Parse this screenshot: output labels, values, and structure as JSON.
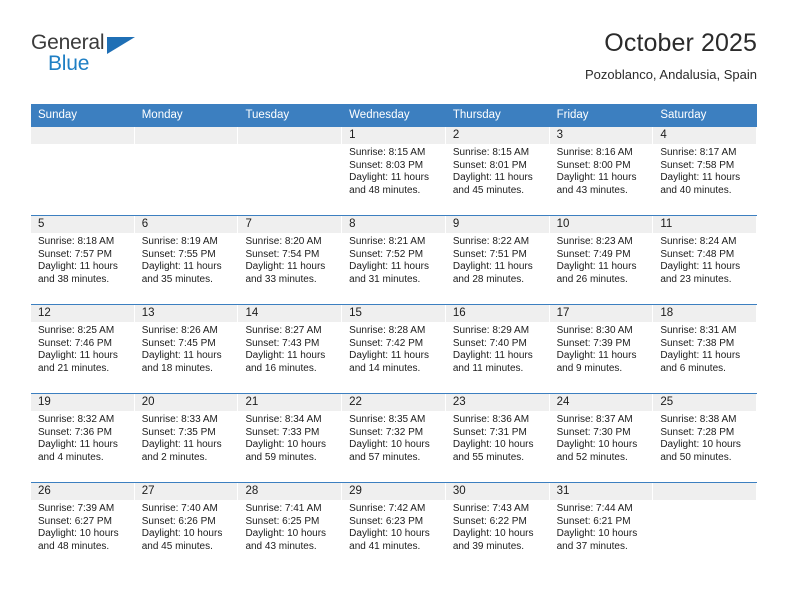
{
  "brand": {
    "name_top": "General",
    "name_bottom": "Blue",
    "accent_color": "#1f7fc4",
    "triangle_color": "#1f6fb5"
  },
  "header": {
    "title": "October 2025",
    "subtitle": "Pozoblanco, Andalusia, Spain"
  },
  "calendar": {
    "header_bg": "#3c7fc0",
    "date_band_bg": "#efefef",
    "weekdays": [
      "Sunday",
      "Monday",
      "Tuesday",
      "Wednesday",
      "Thursday",
      "Friday",
      "Saturday"
    ],
    "labels": {
      "sunrise": "Sunrise:",
      "sunset": "Sunset:",
      "daylight": "Daylight:"
    },
    "weeks": [
      [
        {
          "day": "",
          "empty": true
        },
        {
          "day": "",
          "empty": true
        },
        {
          "day": "",
          "empty": true
        },
        {
          "day": "1",
          "sunrise": "Sunrise: 8:15 AM",
          "sunset": "Sunset: 8:03 PM",
          "daylight1": "Daylight: 11 hours",
          "daylight2": "and 48 minutes."
        },
        {
          "day": "2",
          "sunrise": "Sunrise: 8:15 AM",
          "sunset": "Sunset: 8:01 PM",
          "daylight1": "Daylight: 11 hours",
          "daylight2": "and 45 minutes."
        },
        {
          "day": "3",
          "sunrise": "Sunrise: 8:16 AM",
          "sunset": "Sunset: 8:00 PM",
          "daylight1": "Daylight: 11 hours",
          "daylight2": "and 43 minutes."
        },
        {
          "day": "4",
          "sunrise": "Sunrise: 8:17 AM",
          "sunset": "Sunset: 7:58 PM",
          "daylight1": "Daylight: 11 hours",
          "daylight2": "and 40 minutes."
        }
      ],
      [
        {
          "day": "5",
          "sunrise": "Sunrise: 8:18 AM",
          "sunset": "Sunset: 7:57 PM",
          "daylight1": "Daylight: 11 hours",
          "daylight2": "and 38 minutes."
        },
        {
          "day": "6",
          "sunrise": "Sunrise: 8:19 AM",
          "sunset": "Sunset: 7:55 PM",
          "daylight1": "Daylight: 11 hours",
          "daylight2": "and 35 minutes."
        },
        {
          "day": "7",
          "sunrise": "Sunrise: 8:20 AM",
          "sunset": "Sunset: 7:54 PM",
          "daylight1": "Daylight: 11 hours",
          "daylight2": "and 33 minutes."
        },
        {
          "day": "8",
          "sunrise": "Sunrise: 8:21 AM",
          "sunset": "Sunset: 7:52 PM",
          "daylight1": "Daylight: 11 hours",
          "daylight2": "and 31 minutes."
        },
        {
          "day": "9",
          "sunrise": "Sunrise: 8:22 AM",
          "sunset": "Sunset: 7:51 PM",
          "daylight1": "Daylight: 11 hours",
          "daylight2": "and 28 minutes."
        },
        {
          "day": "10",
          "sunrise": "Sunrise: 8:23 AM",
          "sunset": "Sunset: 7:49 PM",
          "daylight1": "Daylight: 11 hours",
          "daylight2": "and 26 minutes."
        },
        {
          "day": "11",
          "sunrise": "Sunrise: 8:24 AM",
          "sunset": "Sunset: 7:48 PM",
          "daylight1": "Daylight: 11 hours",
          "daylight2": "and 23 minutes."
        }
      ],
      [
        {
          "day": "12",
          "sunrise": "Sunrise: 8:25 AM",
          "sunset": "Sunset: 7:46 PM",
          "daylight1": "Daylight: 11 hours",
          "daylight2": "and 21 minutes."
        },
        {
          "day": "13",
          "sunrise": "Sunrise: 8:26 AM",
          "sunset": "Sunset: 7:45 PM",
          "daylight1": "Daylight: 11 hours",
          "daylight2": "and 18 minutes."
        },
        {
          "day": "14",
          "sunrise": "Sunrise: 8:27 AM",
          "sunset": "Sunset: 7:43 PM",
          "daylight1": "Daylight: 11 hours",
          "daylight2": "and 16 minutes."
        },
        {
          "day": "15",
          "sunrise": "Sunrise: 8:28 AM",
          "sunset": "Sunset: 7:42 PM",
          "daylight1": "Daylight: 11 hours",
          "daylight2": "and 14 minutes."
        },
        {
          "day": "16",
          "sunrise": "Sunrise: 8:29 AM",
          "sunset": "Sunset: 7:40 PM",
          "daylight1": "Daylight: 11 hours",
          "daylight2": "and 11 minutes."
        },
        {
          "day": "17",
          "sunrise": "Sunrise: 8:30 AM",
          "sunset": "Sunset: 7:39 PM",
          "daylight1": "Daylight: 11 hours",
          "daylight2": "and 9 minutes."
        },
        {
          "day": "18",
          "sunrise": "Sunrise: 8:31 AM",
          "sunset": "Sunset: 7:38 PM",
          "daylight1": "Daylight: 11 hours",
          "daylight2": "and 6 minutes."
        }
      ],
      [
        {
          "day": "19",
          "sunrise": "Sunrise: 8:32 AM",
          "sunset": "Sunset: 7:36 PM",
          "daylight1": "Daylight: 11 hours",
          "daylight2": "and 4 minutes."
        },
        {
          "day": "20",
          "sunrise": "Sunrise: 8:33 AM",
          "sunset": "Sunset: 7:35 PM",
          "daylight1": "Daylight: 11 hours",
          "daylight2": "and 2 minutes."
        },
        {
          "day": "21",
          "sunrise": "Sunrise: 8:34 AM",
          "sunset": "Sunset: 7:33 PM",
          "daylight1": "Daylight: 10 hours",
          "daylight2": "and 59 minutes."
        },
        {
          "day": "22",
          "sunrise": "Sunrise: 8:35 AM",
          "sunset": "Sunset: 7:32 PM",
          "daylight1": "Daylight: 10 hours",
          "daylight2": "and 57 minutes."
        },
        {
          "day": "23",
          "sunrise": "Sunrise: 8:36 AM",
          "sunset": "Sunset: 7:31 PM",
          "daylight1": "Daylight: 10 hours",
          "daylight2": "and 55 minutes."
        },
        {
          "day": "24",
          "sunrise": "Sunrise: 8:37 AM",
          "sunset": "Sunset: 7:30 PM",
          "daylight1": "Daylight: 10 hours",
          "daylight2": "and 52 minutes."
        },
        {
          "day": "25",
          "sunrise": "Sunrise: 8:38 AM",
          "sunset": "Sunset: 7:28 PM",
          "daylight1": "Daylight: 10 hours",
          "daylight2": "and 50 minutes."
        }
      ],
      [
        {
          "day": "26",
          "sunrise": "Sunrise: 7:39 AM",
          "sunset": "Sunset: 6:27 PM",
          "daylight1": "Daylight: 10 hours",
          "daylight2": "and 48 minutes."
        },
        {
          "day": "27",
          "sunrise": "Sunrise: 7:40 AM",
          "sunset": "Sunset: 6:26 PM",
          "daylight1": "Daylight: 10 hours",
          "daylight2": "and 45 minutes."
        },
        {
          "day": "28",
          "sunrise": "Sunrise: 7:41 AM",
          "sunset": "Sunset: 6:25 PM",
          "daylight1": "Daylight: 10 hours",
          "daylight2": "and 43 minutes."
        },
        {
          "day": "29",
          "sunrise": "Sunrise: 7:42 AM",
          "sunset": "Sunset: 6:23 PM",
          "daylight1": "Daylight: 10 hours",
          "daylight2": "and 41 minutes."
        },
        {
          "day": "30",
          "sunrise": "Sunrise: 7:43 AM",
          "sunset": "Sunset: 6:22 PM",
          "daylight1": "Daylight: 10 hours",
          "daylight2": "and 39 minutes."
        },
        {
          "day": "31",
          "sunrise": "Sunrise: 7:44 AM",
          "sunset": "Sunset: 6:21 PM",
          "daylight1": "Daylight: 10 hours",
          "daylight2": "and 37 minutes."
        },
        {
          "day": "",
          "empty": true
        }
      ]
    ]
  }
}
